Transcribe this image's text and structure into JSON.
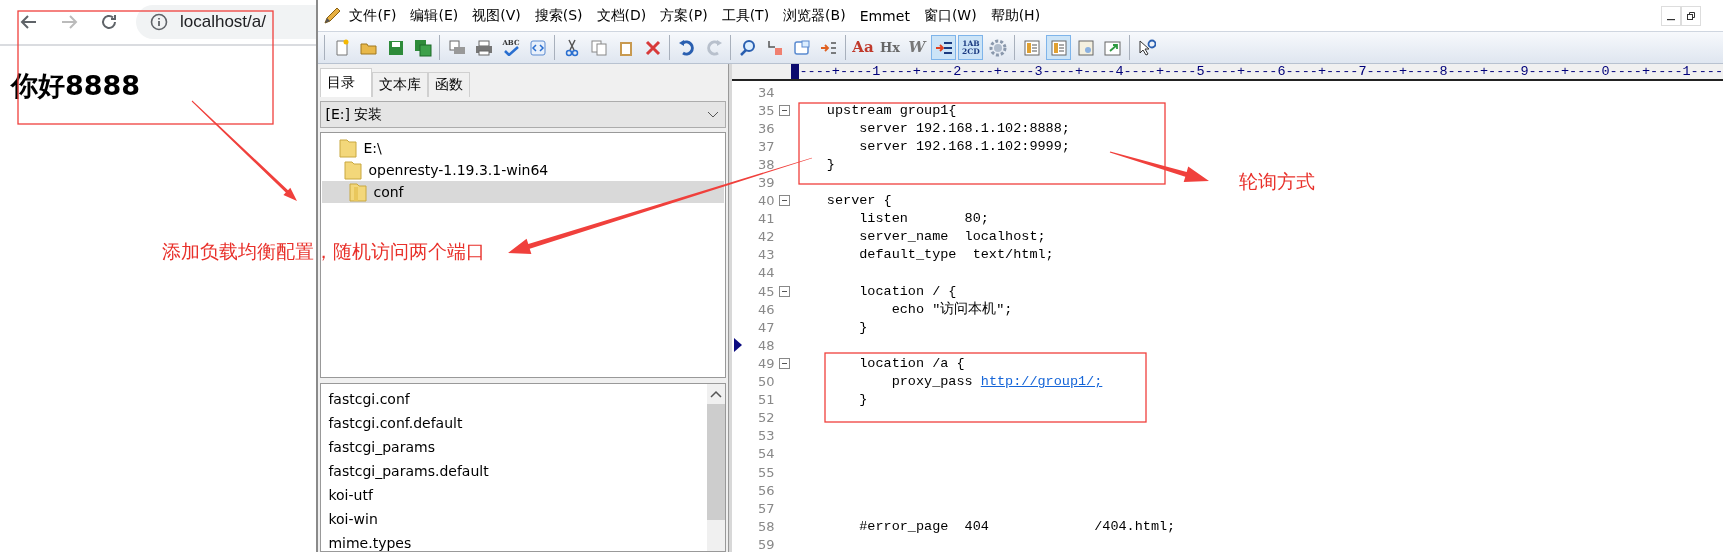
{
  "browser": {
    "nav": [
      {
        "kind": "back",
        "disabled": false
      },
      {
        "kind": "forward",
        "disabled": true
      },
      {
        "kind": "reload",
        "disabled": false
      }
    ],
    "address": "localhost/a/",
    "heading": "你好8888"
  },
  "editor": {
    "menu": [
      "文件(F)",
      "编辑(E)",
      "视图(V)",
      "搜索(S)",
      "文档(D)",
      "方案(P)",
      "工具(T)",
      "浏览器(B)",
      "Emmet",
      "窗口(W)",
      "帮助(H)"
    ],
    "toolbar": [
      [
        {
          "kind": "new",
          "pressed": false
        },
        {
          "kind": "open",
          "pressed": false
        },
        {
          "kind": "save",
          "pressed": false
        },
        {
          "kind": "saveall",
          "pressed": false
        }
      ],
      [
        {
          "kind": "preview",
          "pressed": false
        },
        {
          "kind": "print",
          "pressed": false
        },
        {
          "kind": "spell",
          "text": "ABC",
          "pressed": false
        },
        {
          "kind": "browser",
          "pressed": false
        }
      ],
      [
        {
          "kind": "cut",
          "pressed": false
        },
        {
          "kind": "copy",
          "pressed": false
        },
        {
          "kind": "paste",
          "pressed": false
        },
        {
          "kind": "delete",
          "pressed": false
        }
      ],
      [
        {
          "kind": "undo",
          "pressed": false
        },
        {
          "kind": "redo",
          "pressed": false
        }
      ],
      [
        {
          "kind": "find",
          "pressed": false
        },
        {
          "kind": "replace",
          "pressed": false
        },
        {
          "kind": "window",
          "pressed": false
        },
        {
          "kind": "goto",
          "pressed": false
        }
      ],
      [
        {
          "kind": "font",
          "text": "Aa",
          "pressed": false
        },
        {
          "kind": "glyph",
          "text": "Hx",
          "pressed": false
        },
        {
          "kind": "italic",
          "text": "W",
          "pressed": false
        },
        {
          "kind": "wrap",
          "pressed": true
        },
        {
          "kind": "linenum",
          "text": "1AB 2CD",
          "pressed": true
        },
        {
          "kind": "gear",
          "pressed": false
        }
      ],
      [
        {
          "kind": "panel",
          "pressed": false
        },
        {
          "kind": "panel",
          "pressed": true
        },
        {
          "kind": "clip",
          "pressed": false
        },
        {
          "kind": "output",
          "pressed": false
        }
      ],
      [
        {
          "kind": "help",
          "pressed": false
        }
      ]
    ],
    "panel": {
      "tabs": [
        {
          "label": "目录",
          "selected": true
        },
        {
          "label": "文本库",
          "selected": false
        },
        {
          "label": "函数",
          "selected": false
        }
      ],
      "drive": "[E:] 安装",
      "tree": [
        {
          "label": "E:\\",
          "selected": false,
          "children": [
            {
              "label": "openresty-1.19.3.1-win64",
              "selected": false,
              "children": [
                {
                  "label": "conf",
                  "selected": true
                }
              ]
            }
          ]
        }
      ],
      "files": [
        "fastcgi.conf",
        "fastcgi.conf.default",
        "fastcgi_params",
        "fastcgi_params.default",
        "koi-utf",
        "koi-win",
        "mime.types"
      ]
    },
    "ruler": "----+----1----+----2----+----3----+----4----+----5----+----6----+----7----+----8----+----9----+----0----+----1----",
    "lines": [
      {
        "number": "34",
        "fold": false,
        "current": false
      },
      {
        "number": "35",
        "text": "    upstream group1{",
        "fold": true,
        "current": false
      },
      {
        "number": "36",
        "text": "        server 192.168.1.102:8888;",
        "fold": false,
        "current": false
      },
      {
        "number": "37",
        "text": "        server 192.168.1.102:9999;",
        "fold": false,
        "current": false
      },
      {
        "number": "38",
        "text": "    }",
        "fold": false,
        "current": false
      },
      {
        "number": "39",
        "fold": false,
        "current": false
      },
      {
        "number": "40",
        "text": "    server {",
        "fold": true,
        "current": false
      },
      {
        "number": "41",
        "text": "        listen       80;",
        "fold": false,
        "current": false
      },
      {
        "number": "42",
        "text": "        server_name  localhost;",
        "fold": false,
        "current": false
      },
      {
        "number": "43",
        "text": "        default_type  text/html;",
        "fold": false,
        "current": false
      },
      {
        "number": "44",
        "fold": false,
        "current": false
      },
      {
        "number": "45",
        "text": "        location / {",
        "fold": true,
        "current": false
      },
      {
        "number": "46",
        "text": "            echo \"访问本机\";",
        "fold": false,
        "current": false
      },
      {
        "number": "47",
        "text": "        }",
        "fold": false,
        "current": false
      },
      {
        "number": "48",
        "fold": false,
        "current": true
      },
      {
        "number": "49",
        "text": "        location /a {",
        "fold": true,
        "current": false
      },
      {
        "number": "50",
        "text": "            proxy_pass ",
        "link": "http://group1/;",
        "fold": false,
        "current": false
      },
      {
        "number": "51",
        "text": "        }",
        "fold": false,
        "current": false
      },
      {
        "number": "52",
        "fold": false,
        "current": false
      },
      {
        "number": "53",
        "fold": false,
        "current": false
      },
      {
        "number": "54",
        "fold": false,
        "current": false
      },
      {
        "number": "55",
        "fold": false,
        "current": false
      },
      {
        "number": "56",
        "fold": false,
        "current": false
      },
      {
        "number": "57",
        "fold": false,
        "current": false
      },
      {
        "number": "58",
        "text": "        #error_page  404             /404.html;",
        "fold": false,
        "current": false
      },
      {
        "number": "59",
        "fold": false,
        "current": false
      }
    ]
  },
  "notes": [
    "添加负载均衡配置，随机访问两个端口",
    "轮询方式"
  ]
}
